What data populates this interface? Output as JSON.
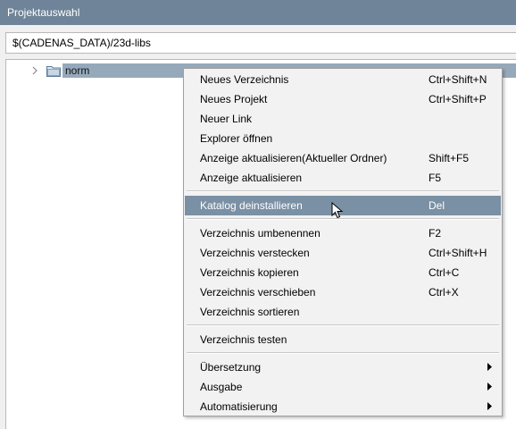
{
  "window": {
    "title": "Projektauswahl"
  },
  "path": {
    "value": "$(CADENAS_DATA)/23d-libs"
  },
  "tree": {
    "items": [
      {
        "label": "norm",
        "selected": true
      }
    ]
  },
  "menu": {
    "items": [
      {
        "label": "Neues Verzeichnis",
        "shortcut": "Ctrl+Shift+N"
      },
      {
        "label": "Neues Projekt",
        "shortcut": "Ctrl+Shift+P"
      },
      {
        "label": "Neuer Link",
        "shortcut": ""
      },
      {
        "label": "Explorer öffnen",
        "shortcut": ""
      },
      {
        "label": "Anzeige aktualisieren(Aktueller Ordner)",
        "shortcut": "Shift+F5"
      },
      {
        "label": "Anzeige aktualisieren",
        "shortcut": "F5"
      },
      {
        "label": "Katalog deinstallieren",
        "shortcut": "Del",
        "highlighted": true
      },
      {
        "label": "Verzeichnis umbenennen",
        "shortcut": "F2"
      },
      {
        "label": "Verzeichnis verstecken",
        "shortcut": "Ctrl+Shift+H"
      },
      {
        "label": "Verzeichnis kopieren",
        "shortcut": "Ctrl+C"
      },
      {
        "label": "Verzeichnis verschieben",
        "shortcut": "Ctrl+X"
      },
      {
        "label": "Verzeichnis sortieren",
        "shortcut": ""
      },
      {
        "label": "Verzeichnis testen",
        "shortcut": ""
      },
      {
        "label": "Übersetzung",
        "submenu": true
      },
      {
        "label": "Ausgabe",
        "submenu": true
      },
      {
        "label": "Automatisierung",
        "submenu": true
      }
    ]
  },
  "colors": {
    "titlebar": "#6f8498",
    "selection": "#96a9bb",
    "menu_highlight": "#7a90a4",
    "menu_background": "#f2f2f2"
  },
  "icons": {
    "expander": "chevron-right-icon",
    "folder": "folder-icon",
    "submenu": "caret-right-icon",
    "cursor": "mouse-pointer-icon"
  }
}
